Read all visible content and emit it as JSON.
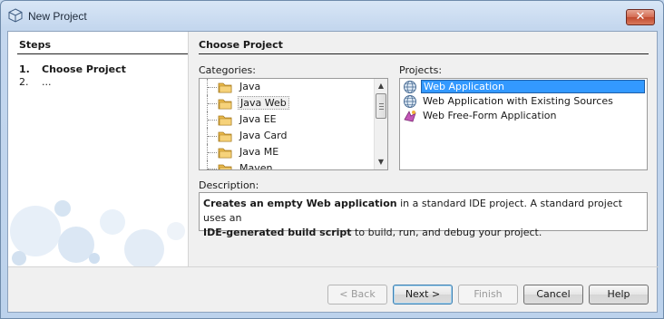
{
  "window": {
    "title": "New Project",
    "close_glyph": "✕"
  },
  "steps": {
    "title": "Steps",
    "items": [
      {
        "num": "1.",
        "label": "Choose Project",
        "current": true
      },
      {
        "num": "2.",
        "label": "...",
        "current": false
      }
    ]
  },
  "content": {
    "title": "Choose Project",
    "categories_label": "Categories:",
    "projects_label": "Projects:",
    "description_label": "Description:",
    "categories": [
      "Java",
      "Java Web",
      "Java EE",
      "Java Card",
      "Java ME",
      "Maven"
    ],
    "selected_category": "Java Web",
    "projects": [
      {
        "label": "Web Application",
        "icon": "globe-icon",
        "selected": true
      },
      {
        "label": "Web Application with Existing Sources",
        "icon": "globe-icon",
        "selected": false
      },
      {
        "label": "Web Free-Form Application",
        "icon": "freeform-icon",
        "selected": false
      }
    ],
    "description": {
      "bold1": "Creates an empty Web application",
      "text1": " in a standard IDE project. A standard project uses an",
      "bold2": "IDE-generated build script",
      "text2": " to build, run, and debug your project."
    }
  },
  "buttons": {
    "back": "< Back",
    "next": "Next >",
    "finish": "Finish",
    "cancel": "Cancel",
    "help": "Help"
  },
  "colors": {
    "selection": "#3399ff",
    "folder": "#e8b84a",
    "close": "#c14a2f"
  }
}
